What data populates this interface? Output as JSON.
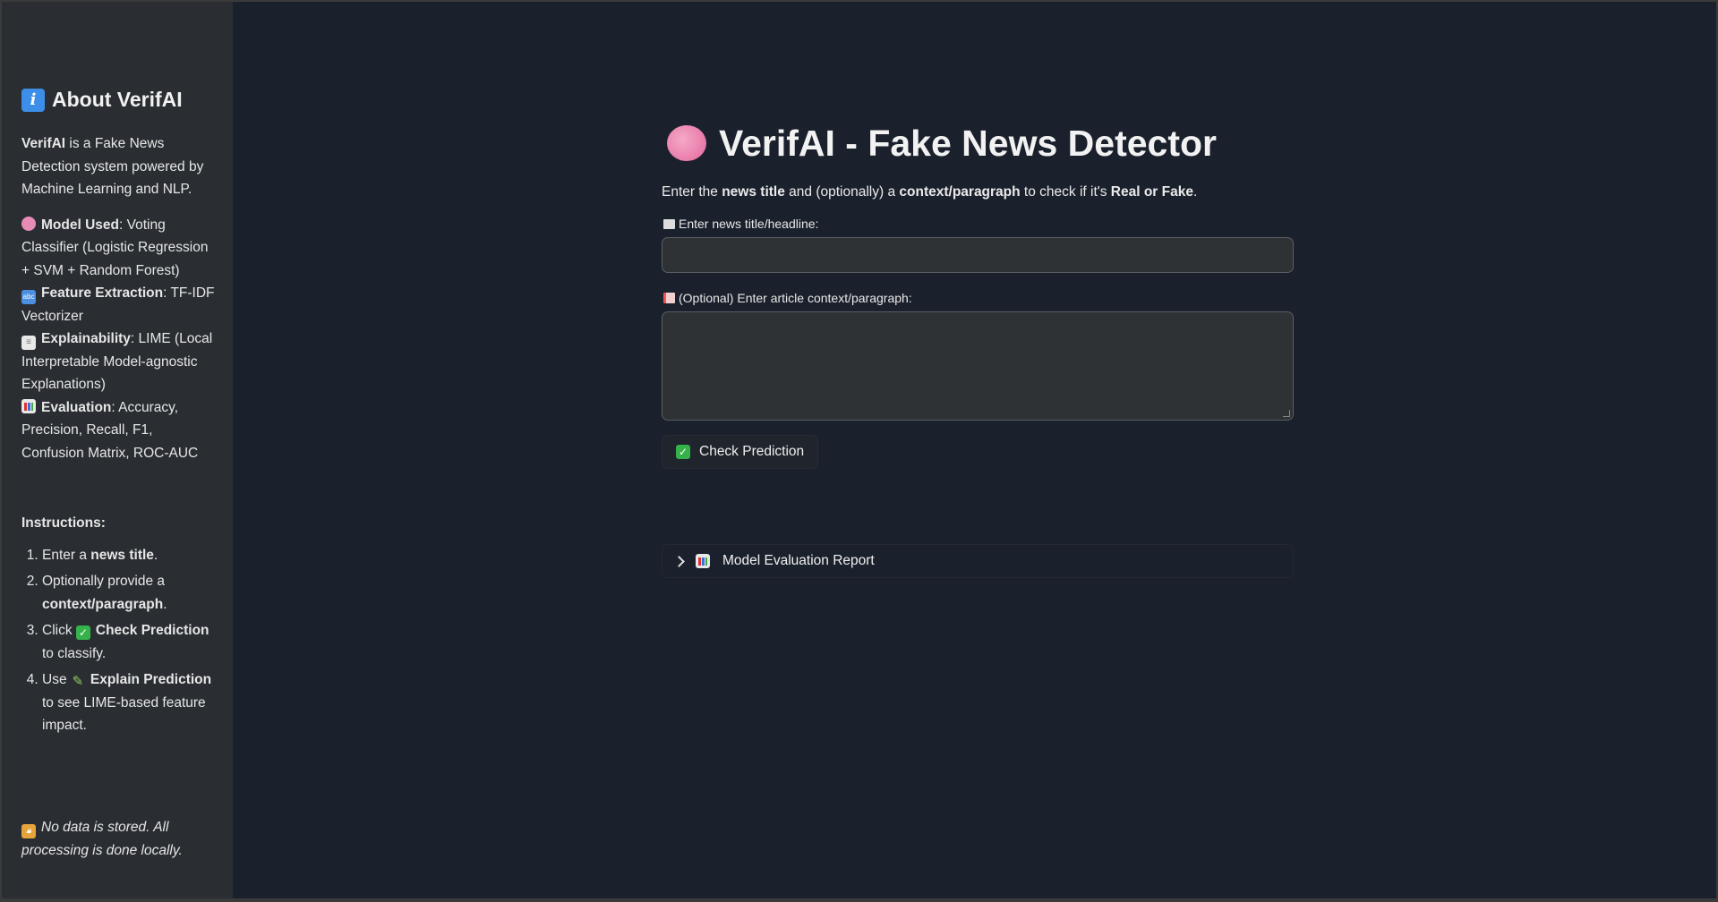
{
  "sidebar": {
    "title": "About VerifAI",
    "intro_bold": "VerifAI",
    "intro_rest": " is a Fake News Detection system powered by Machine Learning and NLP.",
    "items": [
      {
        "icon": "brain-icon",
        "label": "Model Used",
        "text": ": Voting Classifier (Logistic Regression + SVM + Random Forest)"
      },
      {
        "icon": "abc-icon",
        "label": "Feature Extraction",
        "text": ": TF-IDF Vectorizer"
      },
      {
        "icon": "document-icon",
        "label": "Explainability",
        "text": ": LIME (Local Interpretable Model-agnostic Explanations)"
      },
      {
        "icon": "bar-chart-icon",
        "label": "Evaluation",
        "text": ": Accuracy, Precision, Recall, F1, Confusion Matrix, ROC-AUC"
      }
    ],
    "instructions_heading": "Instructions:",
    "steps": [
      {
        "pre": "Enter a ",
        "bold": "news title",
        "post": "."
      },
      {
        "pre": "Optionally provide a ",
        "bold": "context/paragraph",
        "post": "."
      },
      {
        "pre": "Click ",
        "bold": "Check Prediction",
        "post": " to classify."
      },
      {
        "pre": "Use ",
        "bold": "Explain Prediction",
        "post": " to see LIME-based feature impact."
      }
    ],
    "footer": "No data is stored. All processing is done locally."
  },
  "main": {
    "title": "VerifAI - Fake News Detector",
    "subtitle": {
      "p1": "Enter the ",
      "b1": "news title",
      "p2": " and (optionally) a ",
      "b2": "context/paragraph",
      "p3": " to check if it's ",
      "b3": "Real or Fake",
      "p4": "."
    },
    "title_input": {
      "label": "Enter news title/headline:",
      "value": ""
    },
    "context_input": {
      "label": "(Optional) Enter article context/paragraph:",
      "value": ""
    },
    "check_button": "Check Prediction",
    "expander_label": "Model Evaluation Report"
  },
  "colors": {
    "sidebar_bg": "#2a2e33",
    "main_bg": "#1b212c",
    "input_bg": "#2f3234"
  }
}
